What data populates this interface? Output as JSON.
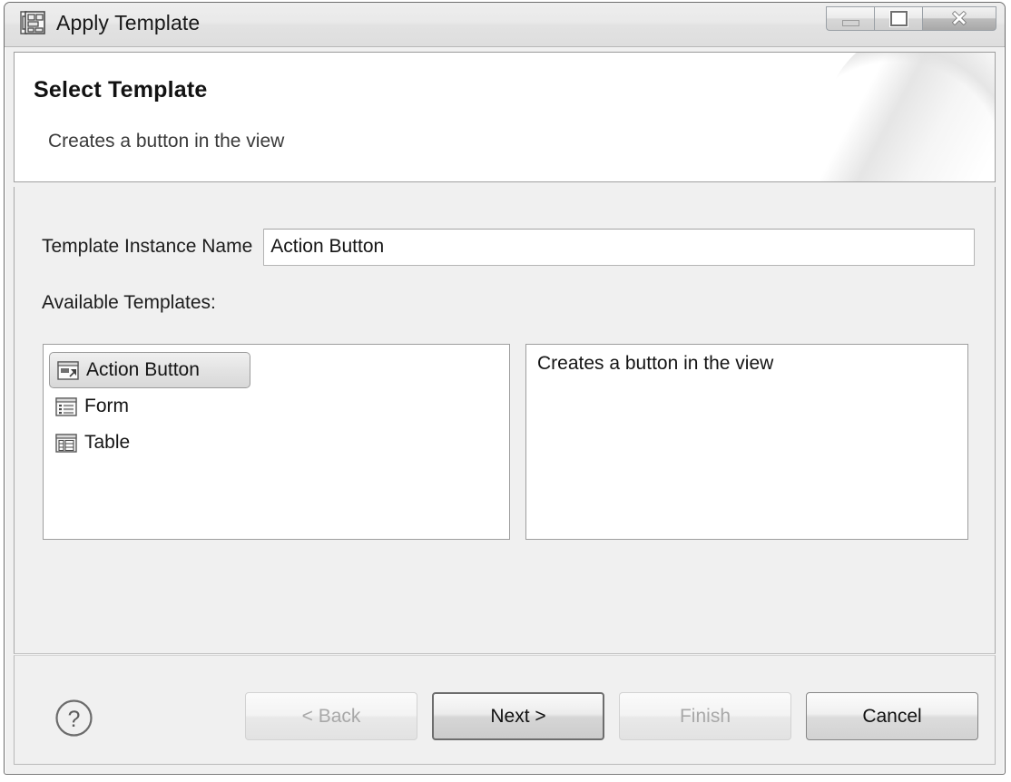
{
  "window": {
    "title": "Apply Template",
    "icon": "template-grid-icon",
    "controls": {
      "minimize": "minimize-icon",
      "maximize": "restore-icon",
      "close": "close-icon"
    }
  },
  "header": {
    "title": "Select Template",
    "subtitle": "Creates a button in the view"
  },
  "form": {
    "name_label": "Template Instance Name",
    "name_value": "Action Button",
    "name_placeholder": "",
    "available_label": "Available Templates:"
  },
  "templates": [
    {
      "label": "Action Button",
      "icon": "action-button-icon",
      "selected": true
    },
    {
      "label": "Form",
      "icon": "form-icon",
      "selected": false
    },
    {
      "label": "Table",
      "icon": "table-icon",
      "selected": false
    }
  ],
  "description": {
    "text": "Creates a button in the view"
  },
  "footer": {
    "help_icon": "help-icon",
    "buttons": [
      {
        "label": "< Back",
        "state": "disabled"
      },
      {
        "label": "Next >",
        "state": "default"
      },
      {
        "label": "Finish",
        "state": "disabled"
      },
      {
        "label": "Cancel",
        "state": "enabled"
      }
    ]
  },
  "colors": {
    "window_bg": "#f0f0f0",
    "panel_bg": "#ffffff",
    "border": "#9e9e9e",
    "text": "#141414",
    "disabled_text": "#a8a8a8"
  }
}
